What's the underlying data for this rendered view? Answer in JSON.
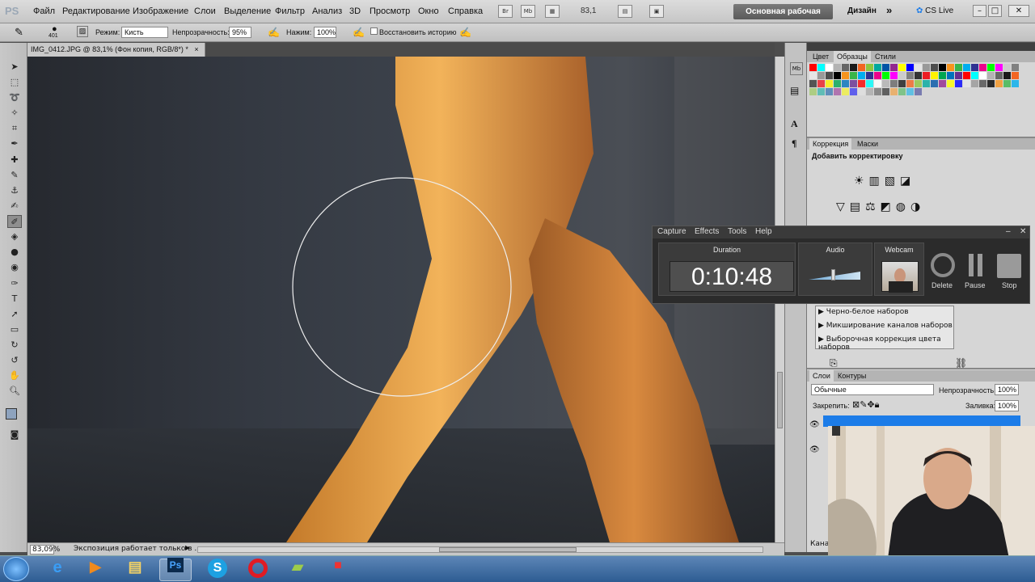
{
  "app": {
    "logo": "PS"
  },
  "menu": [
    "Файл",
    "Редактирование",
    "Изображение",
    "Слои",
    "Выделение",
    "Фильтр",
    "Анализ",
    "3D",
    "Просмотр",
    "Окно",
    "Справка"
  ],
  "menubar_icons": {
    "bridge": "Br",
    "minibridge": "Mb"
  },
  "zoom_value": "83,1",
  "workspace": {
    "active": "Основная рабочая среда",
    "design": "Дизайн",
    "more": "»",
    "cslive": "CS Live"
  },
  "options": {
    "brush_size": "401",
    "mode_label": "Режим:",
    "mode_value": "Кисть",
    "opacity_label": "Непрозрачность:",
    "opacity_value": "95%",
    "pressure_label": "Нажим:",
    "pressure_value": "100%",
    "restore_label": "Восстановить историю"
  },
  "document": {
    "tab_title": "IMG_0412.JPG @ 83,1% (Фон копия, RGB/8*) *",
    "close": "×"
  },
  "status": {
    "zoom": "83,09%",
    "message": "Экспозиция работает только в ..."
  },
  "panels": {
    "swatch_tabs": [
      "Цвет",
      "Образцы",
      "Стили"
    ],
    "adjust_tabs": [
      "Коррекция",
      "Маски"
    ],
    "adjust_title": "Добавить корректировку",
    "presets": [
      "Черно-белое наборов",
      "Микширование каналов наборов",
      "Выборочная коррекция цвета наборов"
    ],
    "layers_tabs": [
      "Слои",
      "Контуры"
    ],
    "blend_mode": "Обычные",
    "opacity_label": "Непрозрачность:",
    "opacity_value": "100%",
    "lock_label": "Закрепить:",
    "fill_label": "Заливка:",
    "fill_value": "100%",
    "bottom_tab": "Кана"
  },
  "capture": {
    "menu": [
      "Capture",
      "Effects",
      "Tools",
      "Help"
    ],
    "duration_label": "Duration",
    "duration": "0:10:48",
    "audio_label": "Audio",
    "webcam_label": "Webcam",
    "buttons": [
      "Delete",
      "Pause",
      "Stop"
    ]
  },
  "colors": {
    "accent": "#1c7ce8",
    "workspace_btn": "#646464",
    "taskbar": "#3d6ea5"
  }
}
